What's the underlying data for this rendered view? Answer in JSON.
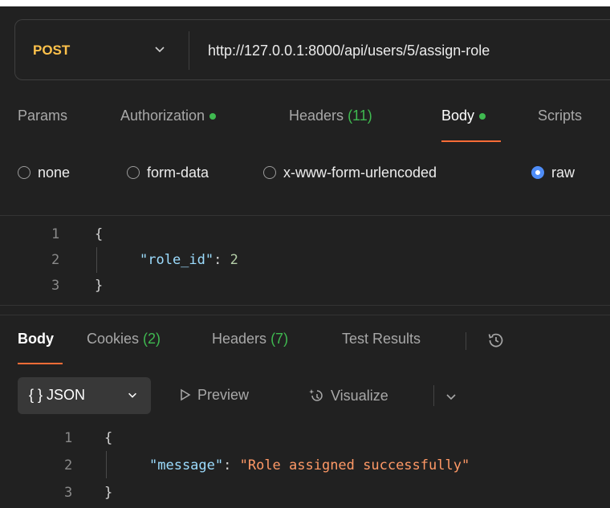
{
  "request": {
    "method": "POST",
    "url": "http://127.0.0.1:8000/api/users/5/assign-role",
    "method_color": "#ffc24b"
  },
  "request_tabs": [
    {
      "label": "Params"
    },
    {
      "label": "Authorization",
      "dot": true
    },
    {
      "label": "Headers",
      "count": "(11)"
    },
    {
      "label": "Body",
      "dot": true,
      "active": true
    },
    {
      "label": "Scripts"
    }
  ],
  "body_types": [
    {
      "label": "none",
      "selected": false
    },
    {
      "label": "form-data",
      "selected": false
    },
    {
      "label": "x-www-form-urlencoded",
      "selected": false
    },
    {
      "label": "raw",
      "selected": true
    }
  ],
  "request_body": {
    "lines": [
      {
        "n": "1",
        "open": "{"
      },
      {
        "n": "2",
        "key": "\"role_id\"",
        "sep": ": ",
        "value": "2"
      },
      {
        "n": "3",
        "close": "}"
      }
    ]
  },
  "response_tabs": [
    {
      "label": "Body",
      "active": true
    },
    {
      "label": "Cookies",
      "count": "(2)"
    },
    {
      "label": "Headers",
      "count": "(7)"
    },
    {
      "label": "Test Results"
    }
  ],
  "response_toolbar": {
    "format": "{ } JSON",
    "preview": "Preview",
    "visualize": "Visualize"
  },
  "response_body": {
    "lines": [
      {
        "n": "1",
        "open": "{"
      },
      {
        "n": "2",
        "key": "\"message\"",
        "sep": ": ",
        "value": "\"Role assigned successfully\""
      },
      {
        "n": "3",
        "close": "}"
      }
    ]
  },
  "colors": {
    "accent": "#ff6c37",
    "success": "#3fb950",
    "radio": "#4f8df7"
  },
  "icons": [
    "chevron-down-icon",
    "history-icon",
    "play-outline-icon",
    "visualize-icon"
  ]
}
